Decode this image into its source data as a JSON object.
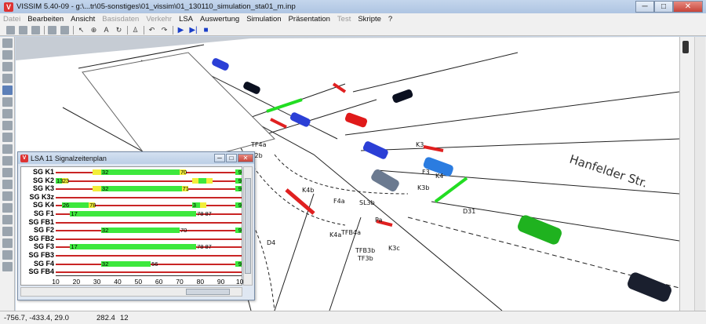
{
  "window": {
    "title": "VISSIM 5.40-09 - g:\\...tr\\05-sonstiges\\01_vissim\\01_130110_simulation_sta01_m.inp"
  },
  "window_buttons": {
    "minimize": "─",
    "maximize": "□",
    "close": "✕"
  },
  "menu": [
    {
      "label": "Datei",
      "disabled": true
    },
    {
      "label": "Bearbeiten",
      "disabled": false
    },
    {
      "label": "Ansicht",
      "disabled": false
    },
    {
      "label": "Basisdaten",
      "disabled": true
    },
    {
      "label": "Verkehr",
      "disabled": true
    },
    {
      "label": "LSA",
      "disabled": false
    },
    {
      "label": "Auswertung",
      "disabled": false
    },
    {
      "label": "Simulation",
      "disabled": false
    },
    {
      "label": "Präsentation",
      "disabled": false
    },
    {
      "label": "Test",
      "disabled": true
    },
    {
      "label": "Skripte",
      "disabled": false
    },
    {
      "label": "?",
      "disabled": false
    }
  ],
  "toolbar_icons": [
    "new-file-icon",
    "open-file-icon",
    "save-icon",
    "print-preview-icon",
    "print-icon",
    "select-pointer-icon",
    "zoom-tool-icon",
    "text-tool-icon",
    "rotate-icon",
    "pedestrian-icon",
    "undo-icon",
    "redo-icon",
    "play-icon",
    "step-forward-icon",
    "stop-icon"
  ],
  "map": {
    "street_name": "Hanfelder Str.",
    "labels": [
      "K4b",
      "K3b",
      "K4a",
      "TFB4a",
      "TFB3b",
      "TF3b",
      "K3c",
      "D31",
      "D4",
      "F4a",
      "SL3b",
      "F3",
      "K4",
      "K3",
      "TF4a",
      "TF2b",
      "Pa"
    ]
  },
  "signal_window": {
    "title": "LSA 11 Signalzeitenplan",
    "buttons": {
      "minimize": "─",
      "maximize": "□",
      "close": "✕"
    },
    "axis": {
      "min": 10,
      "max": 100,
      "ticks": [
        "10",
        "20",
        "30",
        "40",
        "50",
        "60",
        "70",
        "80",
        "90",
        "100"
      ]
    },
    "groups": [
      {
        "name": "SG K1",
        "phases": [
          {
            "color": "yellow",
            "start": 28,
            "end": 32
          },
          {
            "color": "green",
            "start": 32,
            "end": 70
          },
          {
            "color": "yellow",
            "start": 70,
            "end": 73
          },
          {
            "color": "green",
            "start": 97,
            "end": 100
          }
        ],
        "labels": [
          "32",
          "70",
          "9"
        ]
      },
      {
        "name": "SG K2",
        "phases": [
          {
            "color": "green",
            "start": 10,
            "end": 13
          },
          {
            "color": "yellow",
            "start": 13,
            "end": 16
          },
          {
            "color": "yellow",
            "start": 76,
            "end": 79
          },
          {
            "color": "green",
            "start": 79,
            "end": 83
          },
          {
            "color": "yellow",
            "start": 83,
            "end": 86
          },
          {
            "color": "green",
            "start": 97,
            "end": 100
          }
        ],
        "labels": [
          "13",
          "23",
          "9"
        ]
      },
      {
        "name": "SG K3",
        "phases": [
          {
            "color": "yellow",
            "start": 28,
            "end": 32
          },
          {
            "color": "green",
            "start": 32,
            "end": 71
          },
          {
            "color": "yellow",
            "start": 71,
            "end": 74
          },
          {
            "color": "green",
            "start": 97,
            "end": 100
          }
        ],
        "labels": [
          "32",
          "71",
          "9"
        ]
      },
      {
        "name": "SG K3z",
        "phases": [],
        "labels": []
      },
      {
        "name": "SG K4",
        "phases": [
          {
            "color": "green",
            "start": 13,
            "end": 26
          },
          {
            "color": "yellow",
            "start": 26,
            "end": 29
          },
          {
            "color": "green",
            "start": 76,
            "end": 80
          },
          {
            "color": "yellow",
            "start": 80,
            "end": 83
          },
          {
            "color": "green",
            "start": 97,
            "end": 100
          }
        ],
        "labels": [
          "26",
          "78",
          "3",
          "9"
        ]
      },
      {
        "name": "SG F1",
        "phases": [
          {
            "color": "green",
            "start": 17,
            "end": 78
          }
        ],
        "labels": [
          "17",
          "78 87"
        ]
      },
      {
        "name": "SG FB1",
        "phases": [],
        "labels": []
      },
      {
        "name": "SG F2",
        "phases": [
          {
            "color": "green",
            "start": 32,
            "end": 70
          },
          {
            "color": "green",
            "start": 97,
            "end": 100
          }
        ],
        "labels": [
          "32",
          "70",
          "9"
        ]
      },
      {
        "name": "SG FB2",
        "phases": [],
        "labels": []
      },
      {
        "name": "SG F3",
        "phases": [
          {
            "color": "green",
            "start": 17,
            "end": 78
          }
        ],
        "labels": [
          "17",
          "78 87"
        ]
      },
      {
        "name": "SG FB3",
        "phases": [],
        "labels": []
      },
      {
        "name": "SG F4",
        "phases": [
          {
            "color": "green",
            "start": 32,
            "end": 56
          },
          {
            "color": "green",
            "start": 97,
            "end": 100
          }
        ],
        "labels": [
          "32",
          "56",
          "9"
        ]
      },
      {
        "name": "SG FB4",
        "phases": [],
        "labels": []
      }
    ]
  },
  "status": {
    "coords": "-756.7, -433.4, 29.0",
    "value1": "282.4",
    "value2": "12"
  }
}
